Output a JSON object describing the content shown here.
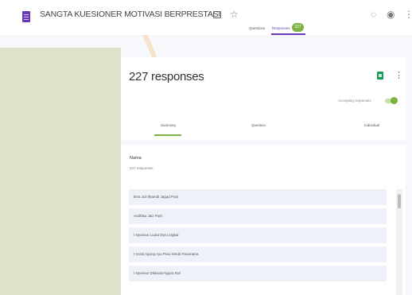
{
  "header": {
    "form_title": "SANGTA KUESIONER MOTIVASI BERPRESTASI"
  },
  "tabs": {
    "questions": "Questions",
    "responses": "Responses",
    "responses_badge": "227"
  },
  "summary": {
    "responses_count": "227 responses",
    "accepting_label": "Accepting responses",
    "accepting": true,
    "subtabs": [
      "Summary",
      "Question",
      "Individual"
    ]
  },
  "question": {
    "title": "Nama",
    "count": "227 responses",
    "answers": [
      "Ilma Juli Ilhamdi Jagad Putri",
      "Andhika Jaiz Putri",
      "I Nyoman Ludra Dwi Lingkar",
      "I Gusti Agung Ayu Putu Ninda Paramarta",
      "I Nyoman Dikbuda Ngura Rivi"
    ]
  },
  "colors": {
    "accent_purple": "#673ab7",
    "accent_green": "#7cb342",
    "left_panel": "#dde3c9"
  },
  "icons": {
    "doc": "forms-doc-icon",
    "folder": "folder-icon",
    "star": "star-icon",
    "palette": "palette-icon",
    "preview": "eye-icon",
    "more": "more-vert-icon",
    "sheets": "sheets-icon"
  }
}
